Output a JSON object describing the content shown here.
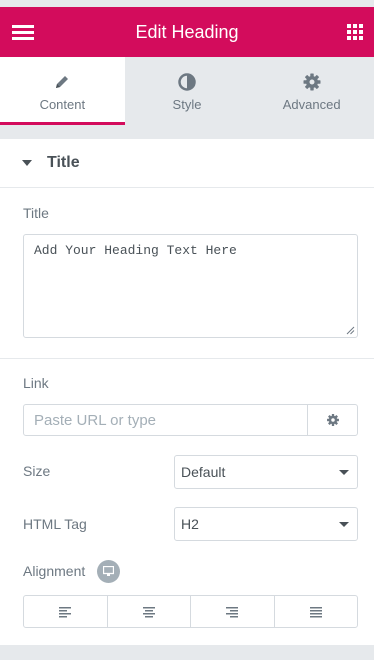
{
  "header": {
    "title": "Edit Heading",
    "menu_icon": "hamburger-icon",
    "apps_icon": "grid-icon",
    "background": "#d30c5c"
  },
  "tabs": [
    {
      "label": "Content",
      "icon": "pencil-icon",
      "active": true
    },
    {
      "label": "Style",
      "icon": "half-circle-icon",
      "active": false
    },
    {
      "label": "Advanced",
      "icon": "gear-icon",
      "active": false
    }
  ],
  "section": {
    "title": "Title",
    "expanded": true
  },
  "controls": {
    "title_label": "Title",
    "title_value": "Add Your Heading Text Here",
    "link_label": "Link",
    "link_placeholder": "Paste URL or type",
    "size_label": "Size",
    "size_value": "Default",
    "html_tag_label": "HTML Tag",
    "html_tag_value": "H2",
    "alignment_label": "Alignment",
    "alignment_options": [
      "left",
      "center",
      "right",
      "justify"
    ]
  },
  "colors": {
    "accent": "#d30c5c",
    "text": "#6d7882",
    "border": "#d5dadf"
  }
}
